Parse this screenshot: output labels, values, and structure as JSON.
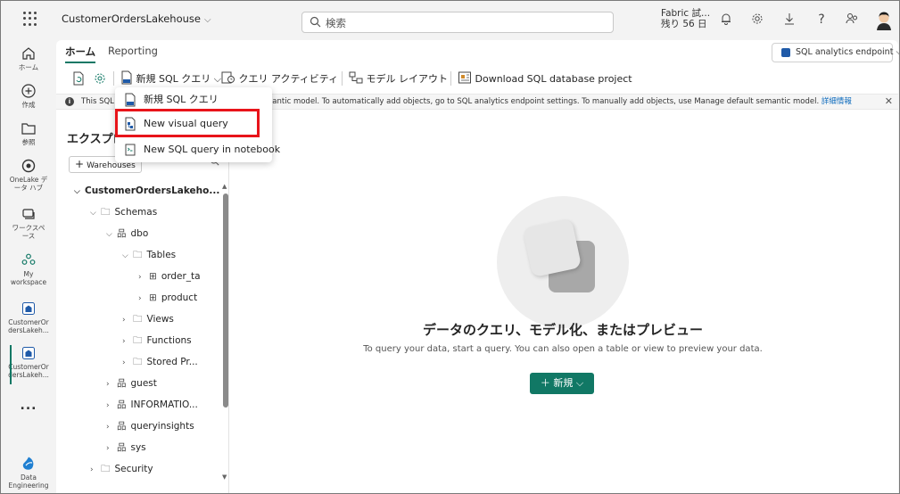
{
  "topbar": {
    "workspace_title": "CustomerOrdersLakehouse",
    "search_placeholder": "検索",
    "trial_line1": "Fabric 試...",
    "trial_line2": "残り 56 日",
    "icons": [
      "waffle-icon",
      "bell-icon",
      "gear-icon",
      "download-icon",
      "help-icon",
      "share-icon"
    ]
  },
  "leftnav": {
    "items": [
      {
        "label": "ホーム",
        "icon": "home-icon"
      },
      {
        "label": "作成",
        "icon": "create-icon"
      },
      {
        "label": "参照",
        "icon": "folder-icon"
      },
      {
        "label": "OneLake データ ハブ",
        "icon": "onelake-icon"
      },
      {
        "label": "ワークスペース",
        "icon": "workspaces-icon"
      },
      {
        "label": "My workspace",
        "icon": "people-icon"
      },
      {
        "label": "CustomerOrdersLakeh...",
        "icon": "lakehouse-icon"
      },
      {
        "label": "CustomerOrdersLakeh...",
        "icon": "lakehouse-icon"
      },
      {
        "label": "...",
        "icon": "more-icon"
      },
      {
        "label": "Data Engineering",
        "icon": "data-engineering-icon"
      }
    ],
    "item1_line1": "OneLake デ",
    "item1_line2": "ータ ハブ",
    "item2_line1": "ワークスペ",
    "item2_line2": "ース",
    "item3_line1": "My",
    "item3_line2": "workspace",
    "lh1_line1": "CustomerOr",
    "lh1_line2": "dersLakeh...",
    "lh2_line1": "CustomerOr",
    "lh2_line2": "dersLakeh...",
    "de_line1": "Data",
    "de_line2": "Engineering"
  },
  "tabs": {
    "home": "ホーム",
    "reporting": "Reporting"
  },
  "endpoint": {
    "label": "SQL analytics endpoint"
  },
  "toolbar": {
    "new_sql_query": "新規 SQL クエリ",
    "query_activity": "クエリ アクティビティ",
    "model_layout": "モデル レイアウト",
    "download_project": "Download SQL database project"
  },
  "infobar": {
    "text_start": "This SQL",
    "text_rest": "mantic model. To automatically add objects, go to SQL analytics endpoint settings. To manually add objects, use Manage default semantic model.",
    "link": "詳細情報"
  },
  "explorer": {
    "title": "エクスプロ",
    "add_warehouses": "Warehouses",
    "tree": [
      {
        "label": "CustomerOrdersLakeho..."
      },
      {
        "label": "Schemas"
      },
      {
        "label": "dbo"
      },
      {
        "label": "Tables"
      },
      {
        "label": "order_ta"
      },
      {
        "label": "product"
      },
      {
        "label": "Views"
      },
      {
        "label": "Functions"
      },
      {
        "label": "Stored Pr..."
      },
      {
        "label": "guest"
      },
      {
        "label": "INFORMATIO..."
      },
      {
        "label": "queryinsights"
      },
      {
        "label": "sys"
      },
      {
        "label": "Security"
      }
    ]
  },
  "menu": {
    "items": [
      {
        "label": "新規 SQL クエリ"
      },
      {
        "label": "New visual query"
      },
      {
        "label": "New SQL query in notebook"
      }
    ]
  },
  "empty_state": {
    "title": "データのクエリ、モデル化、またはプレビュー",
    "subtitle": "To query your data, start a query. You can also open a table or view to preview your data.",
    "new_button": "新規"
  },
  "colors": {
    "accent": "#117865",
    "highlight": "#e8141a",
    "link": "#0f6cbd"
  }
}
